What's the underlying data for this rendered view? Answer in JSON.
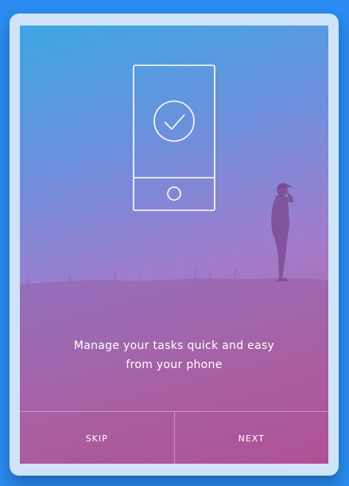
{
  "onboarding": {
    "tagline_line1": "Manage your tasks quick and easy",
    "tagline_line2": "from your phone",
    "skip_label": "SKIP",
    "next_label": "NEXT"
  },
  "colors": {
    "page_background": "#2a8cf0",
    "frame": "#cfe4f7",
    "gradient_top": "#3da6e3",
    "gradient_bottom": "#c45098",
    "text": "#ffffff"
  },
  "icons": {
    "illustration": "phone-check-icon"
  }
}
